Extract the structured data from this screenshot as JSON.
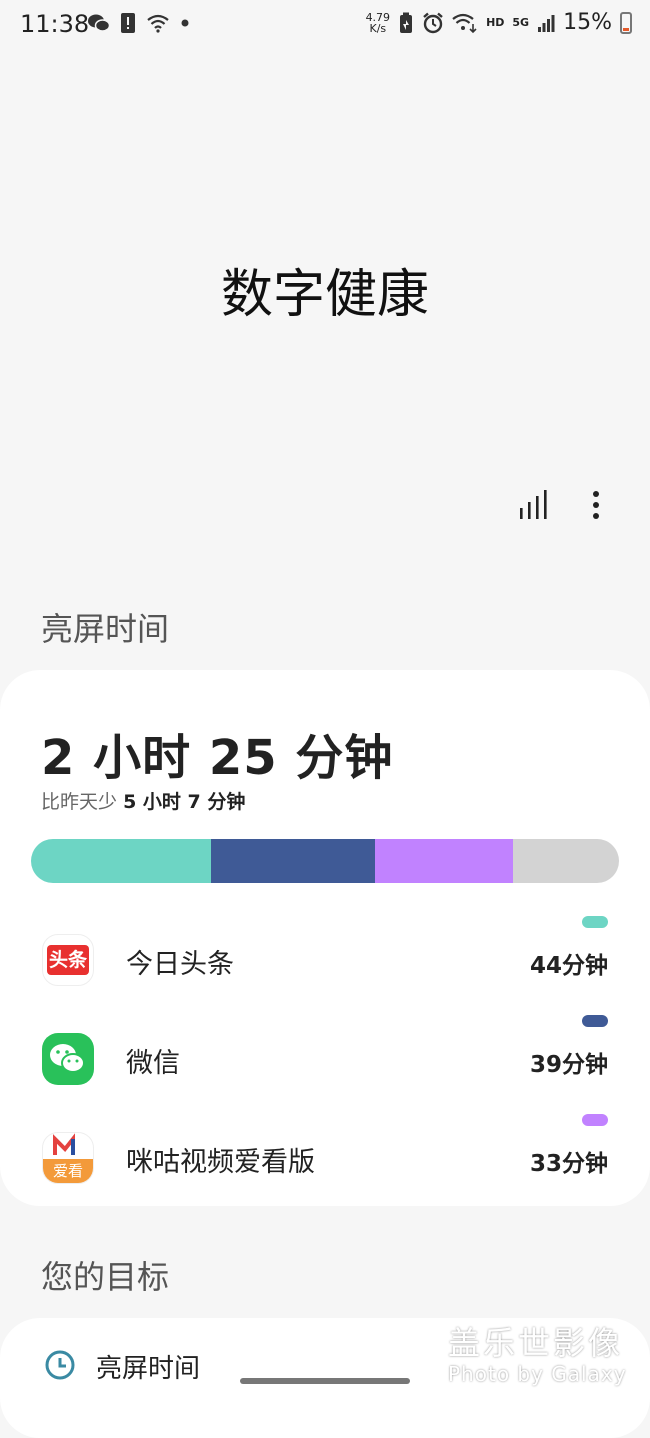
{
  "status_bar": {
    "time": "11:38",
    "net_speed_value": "4.79",
    "net_speed_unit": "K/s",
    "hd": "HD",
    "network_type": "5G",
    "battery": "15%",
    "left_icons": [
      "wechat-icon",
      "alert-icon",
      "wifi-icon",
      "dot-icon"
    ],
    "right_icons": [
      "battery-saver-icon",
      "alarm-icon",
      "wifi-calling-icon",
      "signal-icon",
      "battery-icon"
    ]
  },
  "page": {
    "title": "数字健康"
  },
  "toolbar": {
    "icons": [
      "stats-icon",
      "more-icon"
    ]
  },
  "screen_time": {
    "section_label": "亮屏时间",
    "total": "2 小时 25 分钟",
    "compare_prefix": "比昨天少",
    "compare_value": "5 小时 7 分钟",
    "usage_bar": [
      {
        "name": "今日头条",
        "fraction": 0.306,
        "color": "#6dd5c4"
      },
      {
        "name": "微信",
        "fraction": 0.279,
        "color": "#3f5a96"
      },
      {
        "name": "咪咕视频爱看版",
        "fraction": 0.235,
        "color": "#c182ff"
      },
      {
        "name": "other",
        "fraction": 0.18,
        "color": "#d3d3d3"
      }
    ],
    "apps": [
      {
        "name": "今日头条",
        "time": "44分钟",
        "color": "#6dd5c4",
        "icon_text": "头条"
      },
      {
        "name": "微信",
        "time": "39分钟",
        "color": "#3f5a96",
        "icon_text": ""
      },
      {
        "name": "咪咕视频爱看版",
        "time": "33分钟",
        "color": "#c182ff",
        "icon_text": "爱看"
      }
    ]
  },
  "goals": {
    "section_label": "您的目标",
    "first_item": "亮屏时间"
  },
  "watermark": {
    "cn": "盖乐世影像",
    "en": "Photo by Galaxy"
  }
}
